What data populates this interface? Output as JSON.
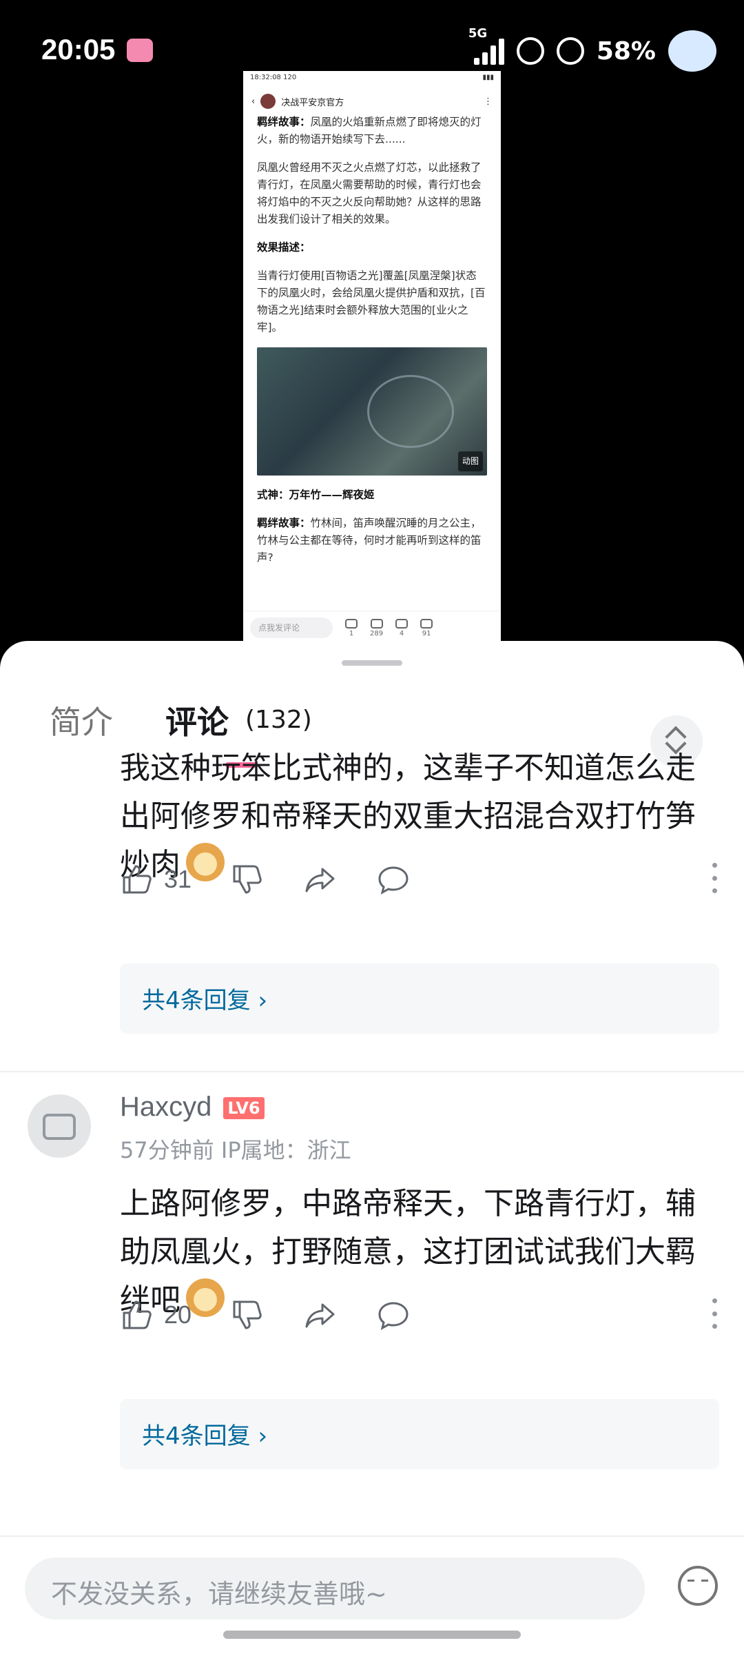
{
  "status_bar": {
    "time": "20:05",
    "network": "5G",
    "battery": "58%"
  },
  "video": {
    "status_time": "18:32:08",
    "status_speed": "120",
    "account_name": "决战平安京官方",
    "paragraph1_label": "羁绊故事：",
    "paragraph1_text": "凤凰的火焰重新点燃了即将熄灭的灯火，新的物语开始续写下去......",
    "paragraph2": "凤凰火曾经用不灭之火点燃了灯芯，以此拯救了青行灯，在凤凰火需要帮助的时候，青行灯也会将灯焰中的不灭之火反向帮助她？从这样的思路出发我们设计了相关的效果。",
    "effect_label": "效果描述：",
    "effect_text": "当青行灯使用[百物语之光]覆盖[凤凰涅槃]状态下的凤凰火时，会给凤凰火提供护盾和双抗，[百物语之光]结束时会额外释放大范围的[业火之牢]。",
    "image_tag": "动图",
    "shikigami_label": "式神：万年竹——辉夜姬",
    "paragraph3_label": "羁绊故事：",
    "paragraph3_text": "竹林间，笛声唤醒沉睡的月之公主，竹林与公主都在等待，何时才能再听到这样的笛声?",
    "input_placeholder": "点我发评论",
    "share_count": "1",
    "comment_count": "289",
    "star_count": "4",
    "like_count": "91"
  },
  "tabs": {
    "intro": "简介",
    "comments": "评论",
    "comment_count": "(132)"
  },
  "comments": [
    {
      "text": "我这种玩笨比式神的，这辈子不知道怎么走出阿修罗和帝释天的双重大招混合双打竹笋炒肉",
      "likes": "31",
      "replies": "共4条回复 ›"
    },
    {
      "user": "Haxcyd",
      "level": "LV6",
      "meta": "57分钟前 IP属地：浙江",
      "text": "上路阿修罗，中路帝释天，下路青行灯，辅助凤凰火，打野随意，这打团试试我们大羁绊吧",
      "likes": "20",
      "replies": "共4条回复 ›"
    }
  ],
  "comment_input": {
    "placeholder": "不发没关系，请继续友善哦~"
  },
  "colors": {
    "accent": "#ff6699",
    "link": "#00699d",
    "level": "#ff6f6f"
  },
  "icons": [
    "like-icon",
    "dislike-icon",
    "share-icon",
    "reply-icon",
    "more-icon",
    "emoji-icon",
    "sort-icon"
  ]
}
